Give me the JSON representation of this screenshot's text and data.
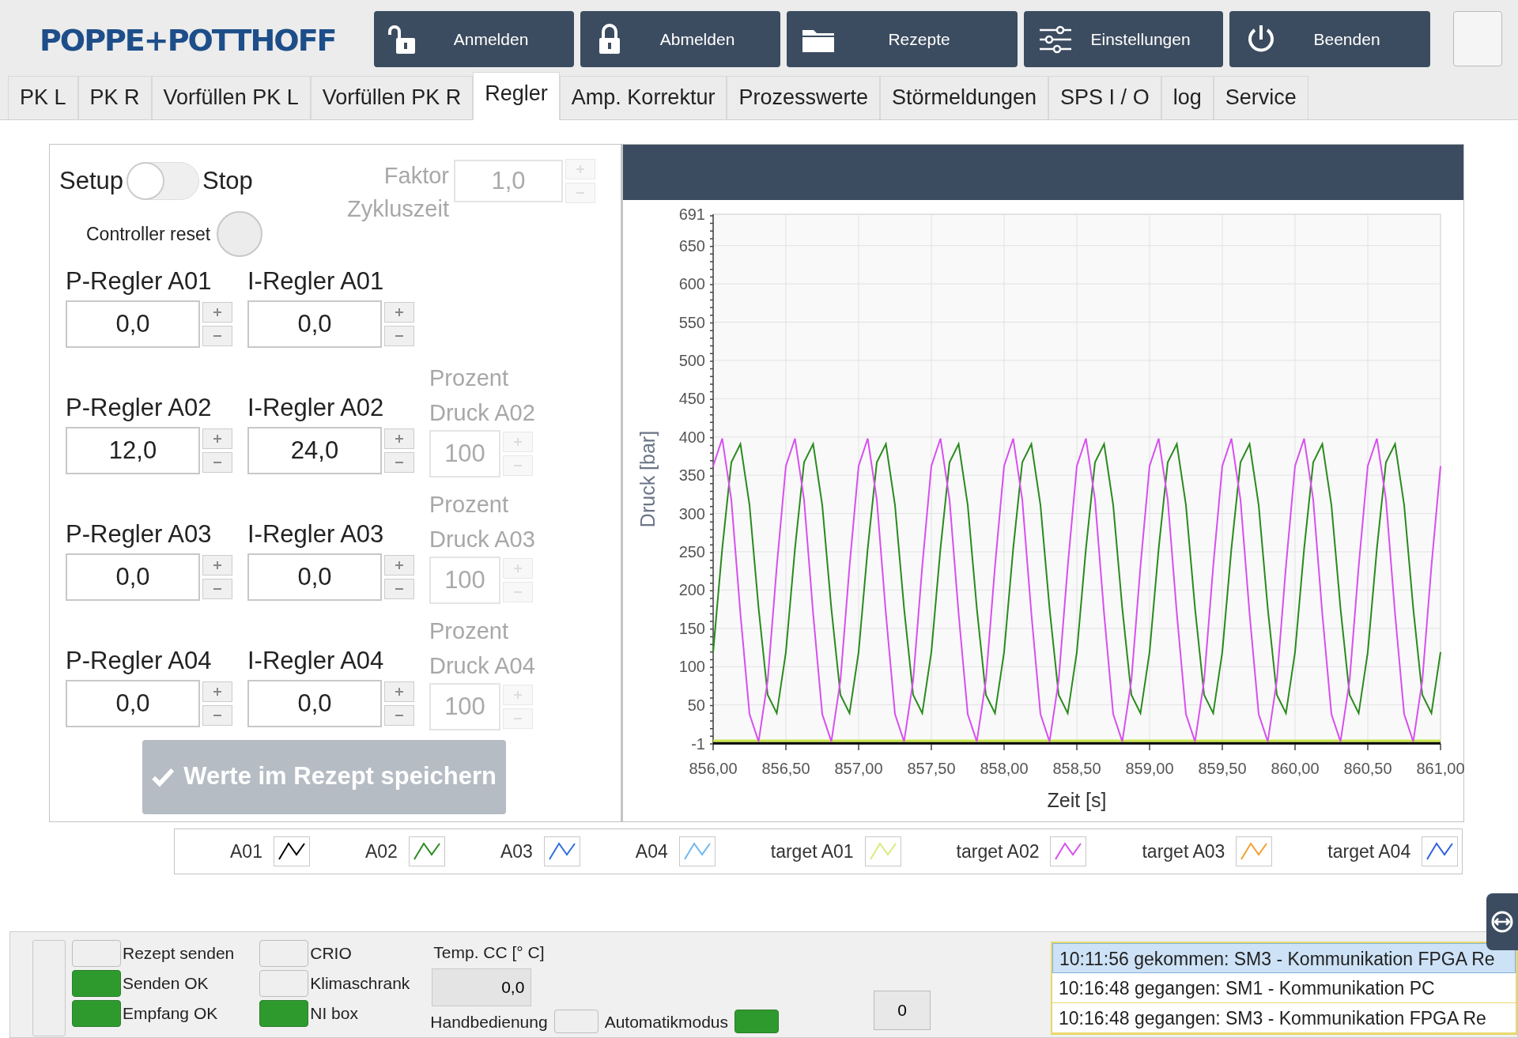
{
  "logo": "POPPE+POTTHOFF",
  "toolbar": [
    {
      "label": "Anmelden",
      "kind": "unlock"
    },
    {
      "label": "Abmelden",
      "kind": "lock"
    },
    {
      "label": "Rezepte",
      "kind": "folder"
    },
    {
      "label": "Einstellungen",
      "kind": "sliders"
    },
    {
      "label": "Beenden",
      "kind": "power"
    }
  ],
  "tabs": [
    {
      "label": "PK L",
      "selected": false
    },
    {
      "label": "PK R",
      "selected": false
    },
    {
      "label": "Vorfüllen PK L",
      "selected": false
    },
    {
      "label": "Vorfüllen PK R",
      "selected": false
    },
    {
      "label": "Regler",
      "selected": true
    },
    {
      "label": "Amp. Korrektur",
      "selected": false
    },
    {
      "label": "Prozesswerte",
      "selected": false
    },
    {
      "label": "Störmeldungen",
      "selected": false
    },
    {
      "label": "SPS I / O",
      "selected": false
    },
    {
      "label": "log",
      "selected": false
    },
    {
      "label": "Service",
      "selected": false
    }
  ],
  "mode_switch": {
    "left_label": "Setup",
    "right_label": "Stop",
    "on": false
  },
  "faktor": {
    "label": "Faktor Zykluszeit",
    "value": "1,0",
    "disabled": true
  },
  "controller_reset": {
    "label": "Controller reset",
    "on": false
  },
  "regler_rows": [
    {
      "p_label": "P-Regler A01",
      "p_value": "0,0",
      "i_label": "I-Regler A01",
      "i_value": "0,0"
    },
    {
      "p_label": "P-Regler A02",
      "p_value": "12,0",
      "i_label": "I-Regler A02",
      "i_value": "24,0",
      "percent": {
        "label": "Prozent Druck A02",
        "value": "100",
        "disabled": true
      }
    },
    {
      "p_label": "P-Regler A03",
      "p_value": "0,0",
      "i_label": "I-Regler A03",
      "i_value": "0,0",
      "percent": {
        "label": "Prozent Druck A03",
        "value": "100",
        "disabled": true
      }
    },
    {
      "p_label": "P-Regler A04",
      "p_value": "0,0",
      "i_label": "I-Regler A04",
      "i_value": "0,0",
      "percent": {
        "label": "Prozent Druck A04",
        "value": "100",
        "disabled": true
      }
    }
  ],
  "save_button": {
    "label": "Werte im Rezept speichern",
    "disabled": true
  },
  "chart": {
    "chart_data": {
      "type": "line",
      "xlabel": "Zeit [s]",
      "ylabel": "Druck [bar]",
      "x": [
        856,
        856.0625,
        856.125,
        856.1875,
        856.25,
        856.3125,
        856.375,
        856.4375,
        856.5,
        856.5625,
        856.625,
        856.6875,
        856.75,
        856.8125,
        856.875,
        856.9375,
        857,
        857.0625,
        857.125,
        857.1875,
        857.25,
        857.3125,
        857.375,
        857.4375,
        857.5,
        857.5625,
        857.625,
        857.6875,
        857.75,
        857.8125,
        857.875,
        857.9375,
        858,
        858.0625,
        858.125,
        858.1875,
        858.25,
        858.3125,
        858.375,
        858.4375,
        858.5,
        858.5625,
        858.625,
        858.6875,
        858.75,
        858.8125,
        858.875,
        858.9375,
        859,
        859.0625,
        859.125,
        859.1875,
        859.25,
        859.3125,
        859.375,
        859.4375,
        859.5,
        859.5625,
        859.625,
        859.6875,
        859.75,
        859.8125,
        859.875,
        859.9375,
        860,
        860.0625,
        860.125,
        860.1875,
        860.25,
        860.3125,
        860.375,
        860.4375,
        860.5,
        860.5625,
        860.625,
        860.6875,
        860.75,
        860.8125,
        860.875,
        860.9375,
        861
      ],
      "series": [
        {
          "color": "#000000",
          "values": [
            0,
            0,
            0,
            0,
            0,
            0,
            0,
            0,
            0,
            0,
            0,
            0,
            0,
            0,
            0,
            0,
            0,
            0,
            0,
            0,
            0,
            0,
            0,
            0,
            0,
            0,
            0,
            0,
            0,
            0,
            0,
            0,
            0,
            0,
            0,
            0,
            0,
            0,
            0,
            0,
            0,
            0,
            0,
            0,
            0,
            0,
            0,
            0,
            0,
            0,
            0,
            0,
            0,
            0,
            0,
            0,
            0,
            0,
            0,
            0,
            0,
            0,
            0,
            0,
            0,
            0,
            0,
            0,
            0,
            0,
            0,
            0,
            0,
            0,
            0,
            0,
            0,
            0,
            0,
            0,
            0
          ]
        },
        {
          "color": "#2a8a1e",
          "values": [
            119,
            254,
            367,
            391,
            311,
            176,
            63,
            39,
            119,
            254,
            367,
            391,
            311,
            176,
            63,
            39,
            119,
            254,
            367,
            391,
            311,
            176,
            63,
            39,
            119,
            254,
            367,
            391,
            311,
            176,
            63,
            39,
            119,
            254,
            367,
            391,
            311,
            176,
            63,
            39,
            119,
            254,
            367,
            391,
            311,
            176,
            63,
            39,
            119,
            254,
            367,
            391,
            311,
            176,
            63,
            39,
            119,
            254,
            367,
            391,
            311,
            176,
            63,
            39,
            119,
            254,
            367,
            391,
            311,
            176,
            63,
            39,
            119,
            254,
            367,
            391,
            311,
            176,
            63,
            39,
            119
          ]
        },
        {
          "color": "#c8e64a",
          "values": [
            3,
            3,
            3,
            3,
            3,
            3,
            3,
            3,
            3,
            3,
            3,
            3,
            3,
            3,
            3,
            3,
            3,
            3,
            3,
            3,
            3,
            3,
            3,
            3,
            3,
            3,
            3,
            3,
            3,
            3,
            3,
            3,
            3,
            3,
            3,
            3,
            3,
            3,
            3,
            3,
            3,
            3,
            3,
            3,
            3,
            3,
            3,
            3,
            3,
            3,
            3,
            3,
            3,
            3,
            3,
            3,
            3,
            3,
            3,
            3,
            3,
            3,
            3,
            3,
            3,
            3,
            3,
            3,
            3,
            3,
            3,
            3,
            3,
            3,
            3,
            3,
            3,
            3,
            3,
            3,
            3
          ]
        },
        {
          "color": "#d84ff0",
          "values": [
            362,
            398,
            318,
            169,
            38,
            2,
            82,
            231,
            362,
            398,
            318,
            169,
            38,
            2,
            82,
            231,
            362,
            398,
            318,
            169,
            38,
            2,
            82,
            231,
            362,
            398,
            318,
            169,
            38,
            2,
            82,
            231,
            362,
            398,
            318,
            169,
            38,
            2,
            82,
            231,
            362,
            398,
            318,
            169,
            38,
            2,
            82,
            231,
            362,
            398,
            318,
            169,
            38,
            2,
            82,
            231,
            362,
            398,
            318,
            169,
            38,
            2,
            82,
            231,
            362,
            398,
            318,
            169,
            38,
            2,
            82,
            231,
            362,
            398,
            318,
            169,
            38,
            2,
            82,
            231,
            362
          ]
        }
      ],
      "xlim": [
        856,
        861
      ],
      "ylim": [
        -1,
        691
      ],
      "grid": true,
      "xticks": [
        {
          "value": 856,
          "label": "856,00"
        },
        {
          "value": 856.5,
          "label": "856,50"
        },
        {
          "value": 857,
          "label": "857,00"
        },
        {
          "value": 857.5,
          "label": "857,50"
        },
        {
          "value": 858,
          "label": "858,00"
        },
        {
          "value": 858.5,
          "label": "858,50"
        },
        {
          "value": 859,
          "label": "859,00"
        },
        {
          "value": 859.5,
          "label": "859,50"
        },
        {
          "value": 860,
          "label": "860,00"
        },
        {
          "value": 860.5,
          "label": "860,50"
        },
        {
          "value": 861,
          "label": "861,00"
        }
      ],
      "yticks": [
        -1,
        50,
        100,
        150,
        200,
        250,
        300,
        350,
        400,
        450,
        500,
        550,
        600,
        650,
        691
      ]
    }
  },
  "legend": [
    {
      "label": "A01",
      "color": "#000000"
    },
    {
      "label": "A02",
      "color": "#2a8a1e"
    },
    {
      "label": "A03",
      "color": "#2f6fe0"
    },
    {
      "label": "A04",
      "color": "#6cb8f0"
    },
    {
      "label": "target A01",
      "color": "#d8ec7a"
    },
    {
      "label": "target A02",
      "color": "#d84ff0"
    },
    {
      "label": "target A03",
      "color": "#f0a030"
    },
    {
      "label": "target A04",
      "color": "#2f5fe0"
    }
  ],
  "status": {
    "indicators_1": [
      {
        "label": "Rezept senden",
        "on": false
      },
      {
        "label": "Senden OK",
        "on": true
      },
      {
        "label": "Empfang OK",
        "on": true
      }
    ],
    "indicators_2": [
      {
        "label": "CRIO",
        "on": false
      },
      {
        "label": "Klimaschrank",
        "on": false
      },
      {
        "label": "NI box",
        "on": true
      }
    ],
    "temp": {
      "label": "Temp. CC [° C]",
      "value": "0,0"
    },
    "modes": [
      {
        "label": "Handbedienung",
        "on": false
      },
      {
        "label": "Automatikmodus",
        "on": true
      }
    ],
    "counter": "0",
    "messages": [
      {
        "text": "10:11:56 gekommen: SM3 - Kommunikation FPGA Re",
        "selected": true
      },
      {
        "text": "10:16:48 gegangen: SM1 - Kommunikation PC",
        "selected": false
      },
      {
        "text": "10:16:48 gegangen: SM3 - Kommunikation FPGA Re",
        "selected": false
      }
    ]
  }
}
